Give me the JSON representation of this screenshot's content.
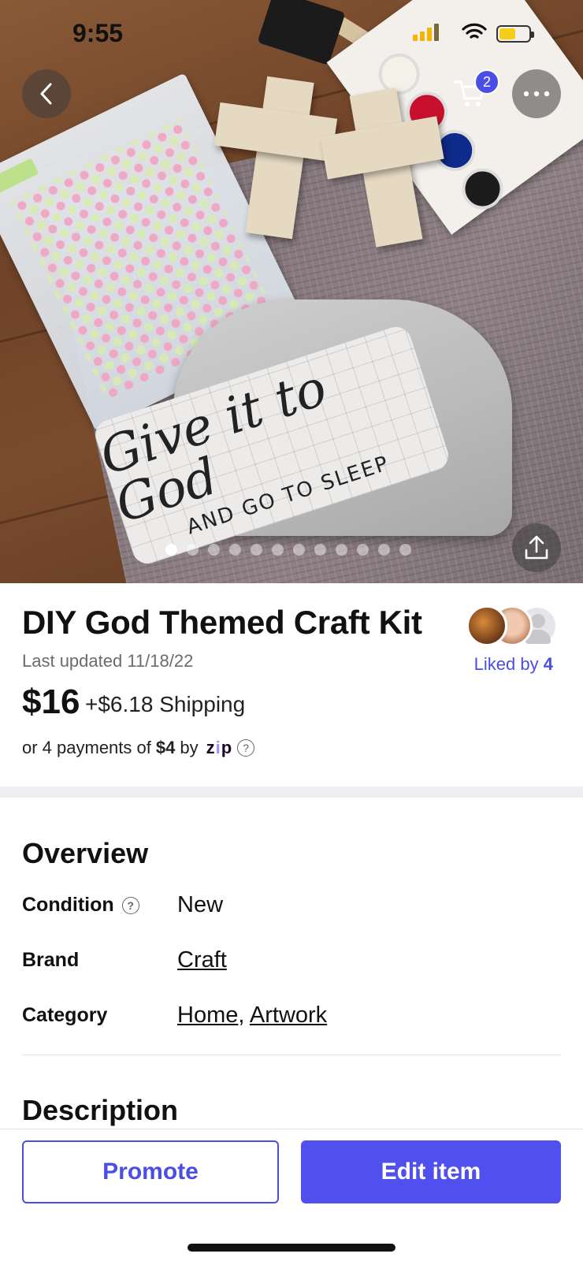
{
  "status_bar": {
    "time": "9:55",
    "battery_level": 0.55
  },
  "header": {
    "cart_count": "2"
  },
  "hero": {
    "image_dots": 12,
    "active_dot": 0,
    "decal_main": "Give it to God",
    "decal_sub": "AND GO TO SLEEP"
  },
  "listing": {
    "title": "DIY God Themed Craft Kit",
    "updated": "Last updated 11/18/22",
    "liked_by_label": "Liked by",
    "liked_by_count": "4",
    "price": "$16",
    "shipping": "+$6.18 Shipping",
    "payments_prefix": "or 4 payments of",
    "payments_amount": "$4",
    "payments_by": "by",
    "zip_brand": "zip"
  },
  "overview": {
    "heading": "Overview",
    "condition_label": "Condition",
    "condition_value": "New",
    "brand_label": "Brand",
    "brand_value": "Craft",
    "category_label": "Category",
    "category_values": [
      "Home",
      "Artwork"
    ],
    "category_separator": ","
  },
  "description": {
    "heading": "Description"
  },
  "actions": {
    "promote_label": "Promote",
    "edit_label": "Edit item"
  },
  "colors": {
    "accent": "#4a4ee6",
    "badge": "#4a4ee6",
    "zip_accent": "#a78bfa"
  },
  "icons": [
    "back-arrow-icon",
    "cart-icon",
    "more-icon",
    "share-icon",
    "help-circle-icon",
    "signal-icon",
    "wifi-icon",
    "battery-icon"
  ]
}
